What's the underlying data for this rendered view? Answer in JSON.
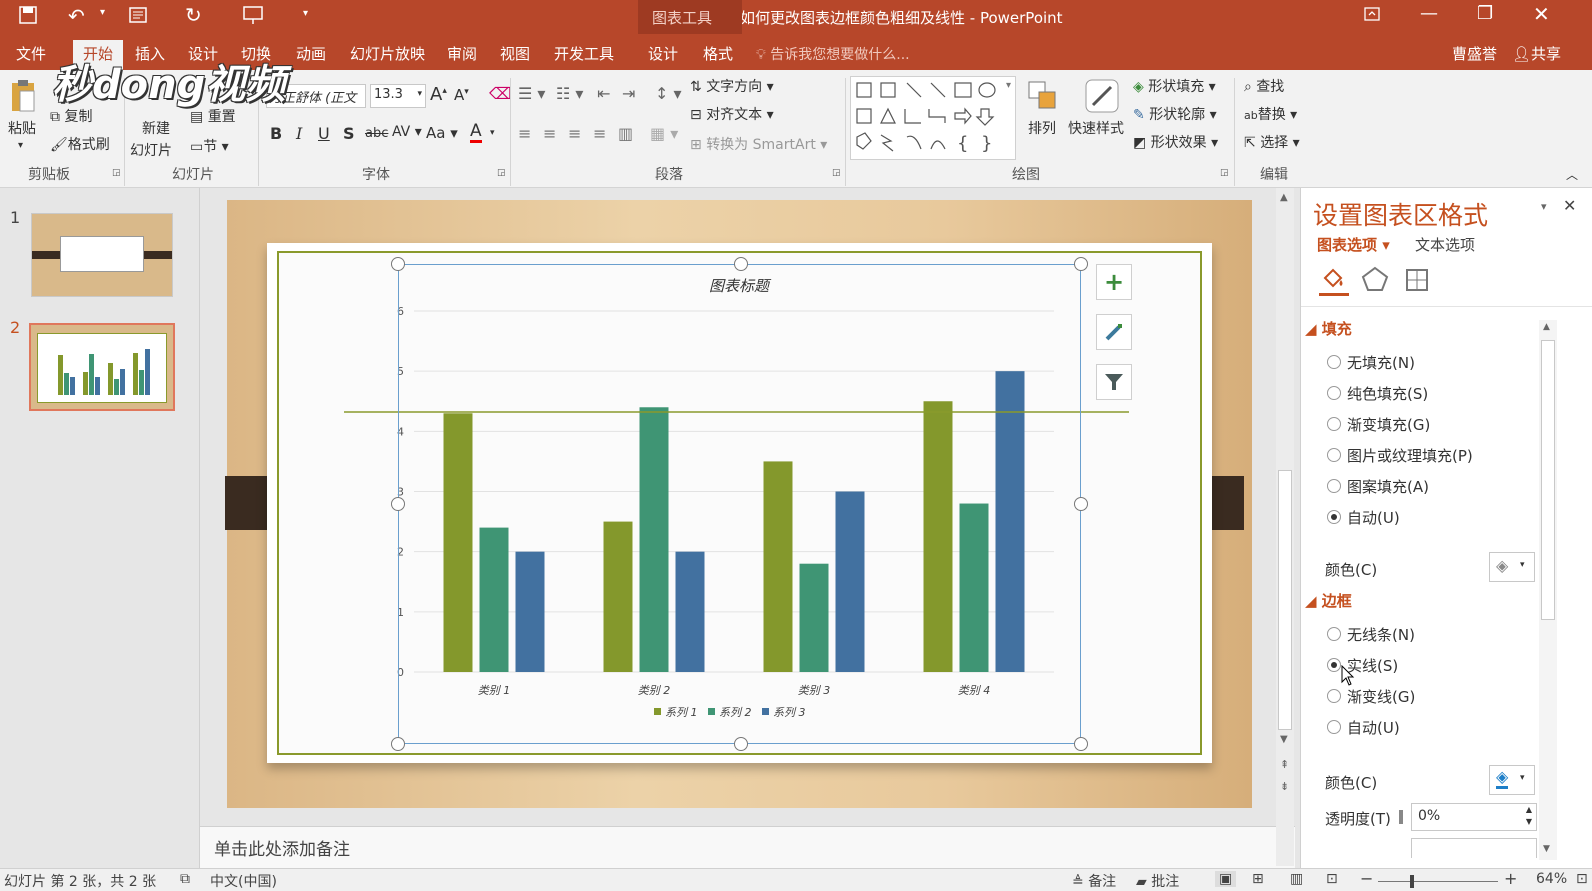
{
  "window": {
    "context_tab": "图表工具",
    "title": "如何更改图表边框颜色粗细及线性 - PowerPoint",
    "user": "曹盛誉",
    "share": "共享"
  },
  "watermark": "秒dong视频",
  "menu": [
    "文件",
    "开始",
    "插入",
    "设计",
    "切换",
    "动画",
    "幻灯片放映",
    "审阅",
    "视图",
    "开发工具",
    "设计",
    "格式"
  ],
  "tell_me": "告诉我您想要做什么...",
  "ribbon": {
    "clipboard": {
      "paste": "粘贴",
      "copy": "复制",
      "format_painter": "格式刷",
      "group": "剪贴板"
    },
    "slides": {
      "new_slide_1": "新建",
      "new_slide_2": "幻灯片",
      "reset": "重置",
      "section": "节",
      "group": "幻灯片"
    },
    "font": {
      "name": "方正舒体 (正文",
      "size": "13.3",
      "group": "字体"
    },
    "paragraph": {
      "text_direction": "文字方向",
      "align_text": "对齐文本",
      "smartart": "转换为 SmartArt",
      "group": "段落"
    },
    "drawing": {
      "arrange": "排列",
      "quick_styles": "快速样式",
      "shape_fill": "形状填充",
      "shape_outline": "形状轮廓",
      "shape_effects": "形状效果",
      "group": "绘图"
    },
    "editing": {
      "find": "查找",
      "replace": "替换",
      "select": "选择",
      "group": "编辑"
    }
  },
  "thumbnails": [
    "1",
    "2"
  ],
  "notes_placeholder": "单击此处添加备注",
  "chart_data": {
    "type": "bar",
    "title": "图表标题",
    "categories": [
      "类别 1",
      "类别 2",
      "类别 3",
      "类别 4"
    ],
    "series": [
      {
        "name": "系列 1",
        "color": "#84982c",
        "values": [
          4.3,
          2.5,
          3.5,
          4.5
        ]
      },
      {
        "name": "系列 2",
        "color": "#3f9574",
        "values": [
          2.4,
          4.4,
          1.8,
          2.8
        ]
      },
      {
        "name": "系列 3",
        "color": "#4271a0",
        "values": [
          2.0,
          2.0,
          3.0,
          5.0
        ]
      }
    ],
    "ylim": [
      0,
      6
    ],
    "yticks": [
      "0",
      "1",
      "2",
      "3",
      "4",
      "5",
      "6"
    ],
    "grid": true,
    "legend": "bottom"
  },
  "pane": {
    "title": "设置图表区格式",
    "tab_chart": "图表选项",
    "tab_text": "文本选项",
    "fill_section": "填充",
    "fill_options": [
      "无填充(N)",
      "纯色填充(S)",
      "渐变填充(G)",
      "图片或纹理填充(P)",
      "图案填充(A)",
      "自动(U)"
    ],
    "fill_selected": 5,
    "fill_color_label": "颜色(C)",
    "border_section": "边框",
    "border_options": [
      "无线条(N)",
      "实线(S)",
      "渐变线(G)",
      "自动(U)"
    ],
    "border_selected": 1,
    "border_color_label": "颜色(C)",
    "transparency_label": "透明度(T)",
    "transparency_value": "0%"
  },
  "status": {
    "slide_info": "幻灯片 第 2 张，共 2 张",
    "language": "中文(中国)",
    "notes": "备注",
    "comments": "批注",
    "zoom": "64%"
  },
  "colors": {
    "accent": "#b7472a",
    "pane_accent": "#c5501f"
  }
}
